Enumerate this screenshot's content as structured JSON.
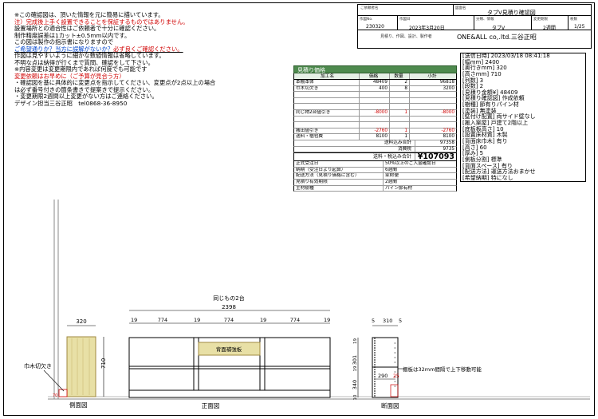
{
  "notes": [
    {
      "text": "※この確認図は、頂いた情報を元に簡易に描いています。",
      "c": ""
    },
    {
      "text": "注）完成後上手く設置できることを保証するものではありません。",
      "c": "red"
    },
    {
      "text": "設置場所との適合性はご依頼者で十分に確認ください。",
      "c": ""
    },
    {
      "text": "制作精度誤差は1カット±0.5mm以内です。",
      "c": ""
    },
    {
      "text": "この図は製作の指示書になりますので",
      "c": ""
    },
    {
      "text": "ご希望通りか？当方に誤解がないか？必ず良くご確認ください。",
      "c": "mix"
    },
    {
      "text": "作図は見やすいように細かな数値情報は省略しています。",
      "c": ""
    },
    {
      "text": "不明な点は納得が行くまで質問、確認をして下さい。",
      "c": ""
    },
    {
      "text": "※内容変更は変更期限内であれば何度でも可能です",
      "c": ""
    },
    {
      "text": "変更依頼はお早めに（ご予算が見合う方）",
      "c": "red"
    },
    {
      "text": "・確認図を基に具体的に変更点を指示してください、変更点が2点以上の場合",
      "c": ""
    },
    {
      "text": "は必ず番号付きの箇条書きで提案きで提示ください。",
      "c": ""
    },
    {
      "text": "・変更期限2週間以上変更がない方はご連絡ください。",
      "c": ""
    },
    {
      "text": "デザイン担当三谷正昭　tel0868-36-8950",
      "c": ""
    }
  ],
  "notes_mix": {
    "blue": "ご希望通りか？当方に誤解がないか？",
    "red": "必ず良くご確認ください。"
  },
  "titleblock": {
    "customer_label": "ご依頼者名",
    "drawing_name_label": "図面名",
    "drawing_name": "タブV見積り確認図",
    "drawing_no_label": "作図No.",
    "drawing_no": "230320",
    "date_label": "作図日",
    "date": "2023年3月20日",
    "category_label": "分類、情報",
    "category": "タブV",
    "deadline_label": "変更期限",
    "deadline": "2週間",
    "page_label": "枚数",
    "page": "1/25",
    "roles": "見積り、作図、設計、製作者",
    "company": "ONE&ALL co,.ltd.三谷正昭"
  },
  "estimate": {
    "title": "見積り価格",
    "headers": [
      "加工名",
      "価格",
      "数量",
      "小計"
    ],
    "rows": [
      [
        "本棚本体",
        "48409",
        "2",
        "96818",
        ""
      ],
      [
        "巾木切欠き",
        "400",
        "8",
        "3200",
        ""
      ],
      [
        "",
        "",
        "",
        "",
        ""
      ],
      [
        "",
        "",
        "",
        "",
        ""
      ],
      [
        "",
        "",
        "",
        "",
        ""
      ],
      [
        "同じ物2台値引き",
        "-8000",
        "1",
        "-8000",
        "neg"
      ],
      [
        "",
        "",
        "",
        "",
        ""
      ],
      [
        "",
        "",
        "",
        "",
        ""
      ],
      [
        "搬出値引き",
        "-2760",
        "1",
        "-2760",
        "neg"
      ],
      [
        "送料・梱包費",
        "8100",
        "1",
        "8100",
        ""
      ]
    ],
    "subtotal_label": "送料込み合計",
    "subtotal": "97358",
    "tax_label": "消費税",
    "tax": "9735",
    "total_label": "送料・税込み合計",
    "total": "¥107093",
    "info": [
      [
        "正式受注日",
        "50%以上のご入金確認日"
      ],
      [
        "納期（受注日より起算）",
        "6週間"
      ],
      [
        "配送方法（見積り価格に含む）",
        "家財便"
      ],
      [
        "見積り有効期限",
        "2週間"
      ],
      [
        "主材樹種",
        "パイン節有材"
      ]
    ]
  },
  "spec": [
    "[送信日時] 2023/03/18 08:41:18",
    "[幅mm] 2400",
    "[奥行きmm] 320",
    "[高さmm] 710",
    "[列数] 3",
    "[段数] 2",
    "[見積り金額¥] 48409",
    "[見積り確認図] 作成依頼",
    "[樹種] 節有りパイン材",
    "[塗装] 無塗装",
    "[壁付け配置] 両サイド壁なし",
    "[搬入案屋] 戸建て2階以上",
    "[底板板高さ] 10",
    "[設置床材質] 木製",
    "[背面床巾木] 有り",
    "[高さ] 60",
    "[厚み] 5",
    "[側板分割] 標準",
    "[背面スペース] 有り",
    "[配送方法] 運送方法おまかせ",
    "[希望納期] 特になし"
  ],
  "drawing": {
    "side_caption": "側面図",
    "front_caption": "正面図",
    "section_caption": "断面図",
    "same_two": "同じもの2台",
    "total_width": "2398",
    "side_depth": "320",
    "height": "710",
    "panel": "19",
    "bay": "774",
    "back_panel": "背面補強板",
    "notch": "巾木切欠き",
    "sec_depth1": "5",
    "sec_depth2": "310",
    "sec_depth3": "5",
    "sec_h1": "301",
    "sec_h2": "19",
    "sec_h3": "340",
    "sec_h4": "19",
    "sec_h5": "10",
    "sec_w": "290",
    "sec_off": "25",
    "shelf_note": "棚板は32mm間隔で上下移動可能",
    "small_70": "70",
    "small_19": "19",
    "small_10": "10",
    "small_40": "40"
  }
}
